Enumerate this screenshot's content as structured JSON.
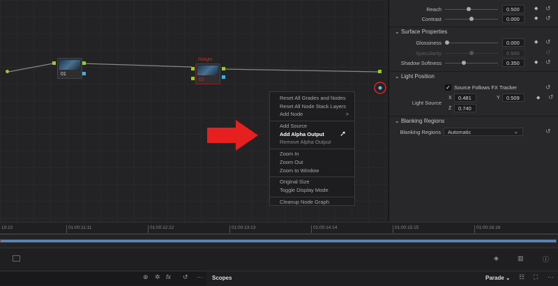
{
  "nodes": [
    {
      "number": "01",
      "label": ""
    },
    {
      "number": "02",
      "label": "Relight"
    }
  ],
  "context_menu": {
    "groups": [
      [
        "Reset All Grades and Nodes",
        "Reset All Node Stack Layers",
        "Add Node"
      ],
      [
        "Add Source",
        "Add Alpha Output",
        "Remove Alpha Output"
      ],
      [
        "Zoom In",
        "Zoom Out",
        "Zoom to Window"
      ],
      [
        "Original Size",
        "Toggle Display Mode"
      ],
      [
        "Cleanup Node Graph"
      ]
    ],
    "submenu_arrow": ">",
    "highlighted": "Add Alpha Output"
  },
  "panel": {
    "reach": {
      "label": "Reach",
      "value": "0.500",
      "fraction": 0.45
    },
    "contrast": {
      "label": "Contrast",
      "value": "0.000",
      "fraction": 0.5
    },
    "surface": {
      "title": "Surface Properties",
      "glossiness": {
        "label": "Glossiness",
        "value": "0.000",
        "fraction": 0.0
      },
      "specularity": {
        "label": "Specularity",
        "value": "0.500",
        "fraction": 0.5
      },
      "shadow_softness": {
        "label": "Shadow Softness",
        "value": "0.350",
        "fraction": 0.35
      }
    },
    "light_position": {
      "title": "Light Position",
      "checkbox_label": "Source Follows FX Tracker",
      "checked": true,
      "light_source_label": "Light Source",
      "x_label": "X",
      "x": "0.481",
      "y_label": "Y",
      "y": "0.509",
      "z_label": "Z",
      "z": "0.740"
    },
    "blanking": {
      "title": "Blanking Regions",
      "label": "Blanking Regions",
      "value": "Automatic"
    }
  },
  "timeline": {
    "ticks": [
      "10:10",
      "01:00:11:11",
      "01:00:12:12",
      "01:00:13:13",
      "01:00:14:14",
      "01:00:15:15",
      "01:00:16:16"
    ]
  },
  "bottom": {
    "scopes_label": "Scopes",
    "parade_label": "Parade",
    "more": "···"
  },
  "colors": {
    "accent_red": "#e5201f",
    "track_blue": "#5f87b3",
    "node_green": "#9bc53d"
  }
}
